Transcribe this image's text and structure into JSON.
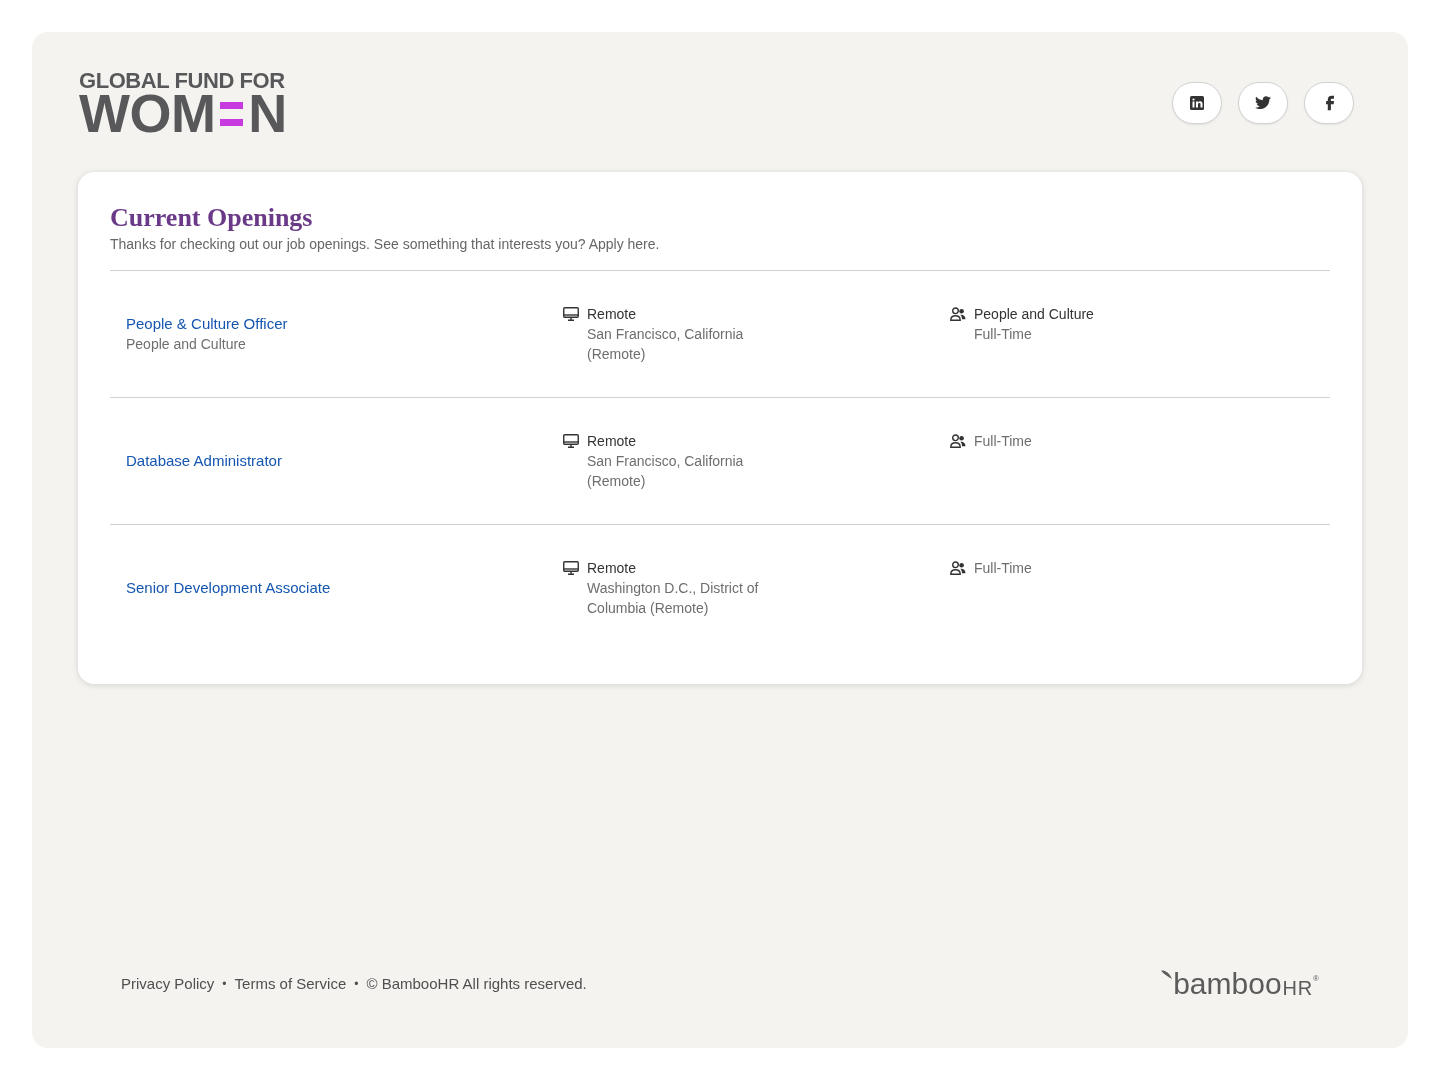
{
  "header": {
    "logo": {
      "line_1": "GLOBAL FUND FOR",
      "line_2_start": "WOM",
      "line_2_end": "N"
    },
    "social_links": [
      {
        "kind": "linkedin"
      },
      {
        "kind": "twitter"
      },
      {
        "kind": "facebook"
      }
    ]
  },
  "openings": {
    "title": "Current Openings",
    "intro": "Thanks for checking out our job openings. See something that interests you? Apply here.",
    "jobs": [
      {
        "title": "People & Culture Officer",
        "department": "People and Culture",
        "location": {
          "type": "Remote",
          "address": "San Francisco, California (Remote)"
        },
        "info": {
          "department": "People and Culture",
          "employment_type": "Full-Time"
        }
      },
      {
        "title": "Database Administrator",
        "location": {
          "type": "Remote",
          "address": "San Francisco, California (Remote)"
        },
        "info": {
          "employment_type": "Full-Time"
        }
      },
      {
        "title": "Senior Development Associate",
        "location": {
          "type": "Remote",
          "address": "Washington D.C., District of Columbia (Remote)"
        },
        "info": {
          "employment_type": "Full-Time"
        }
      }
    ]
  },
  "footer": {
    "items": [
      {
        "kind": "link",
        "text": "Privacy Policy"
      },
      {
        "kind": "separator",
        "text": "•"
      },
      {
        "kind": "link",
        "text": "Terms of Service"
      },
      {
        "kind": "separator",
        "text": "•"
      },
      {
        "kind": "copyright",
        "text": "© BambooHR All rights reserved."
      }
    ],
    "brand": {
      "name": "bamboo",
      "suffix": "HR",
      "mark": "®"
    }
  }
}
